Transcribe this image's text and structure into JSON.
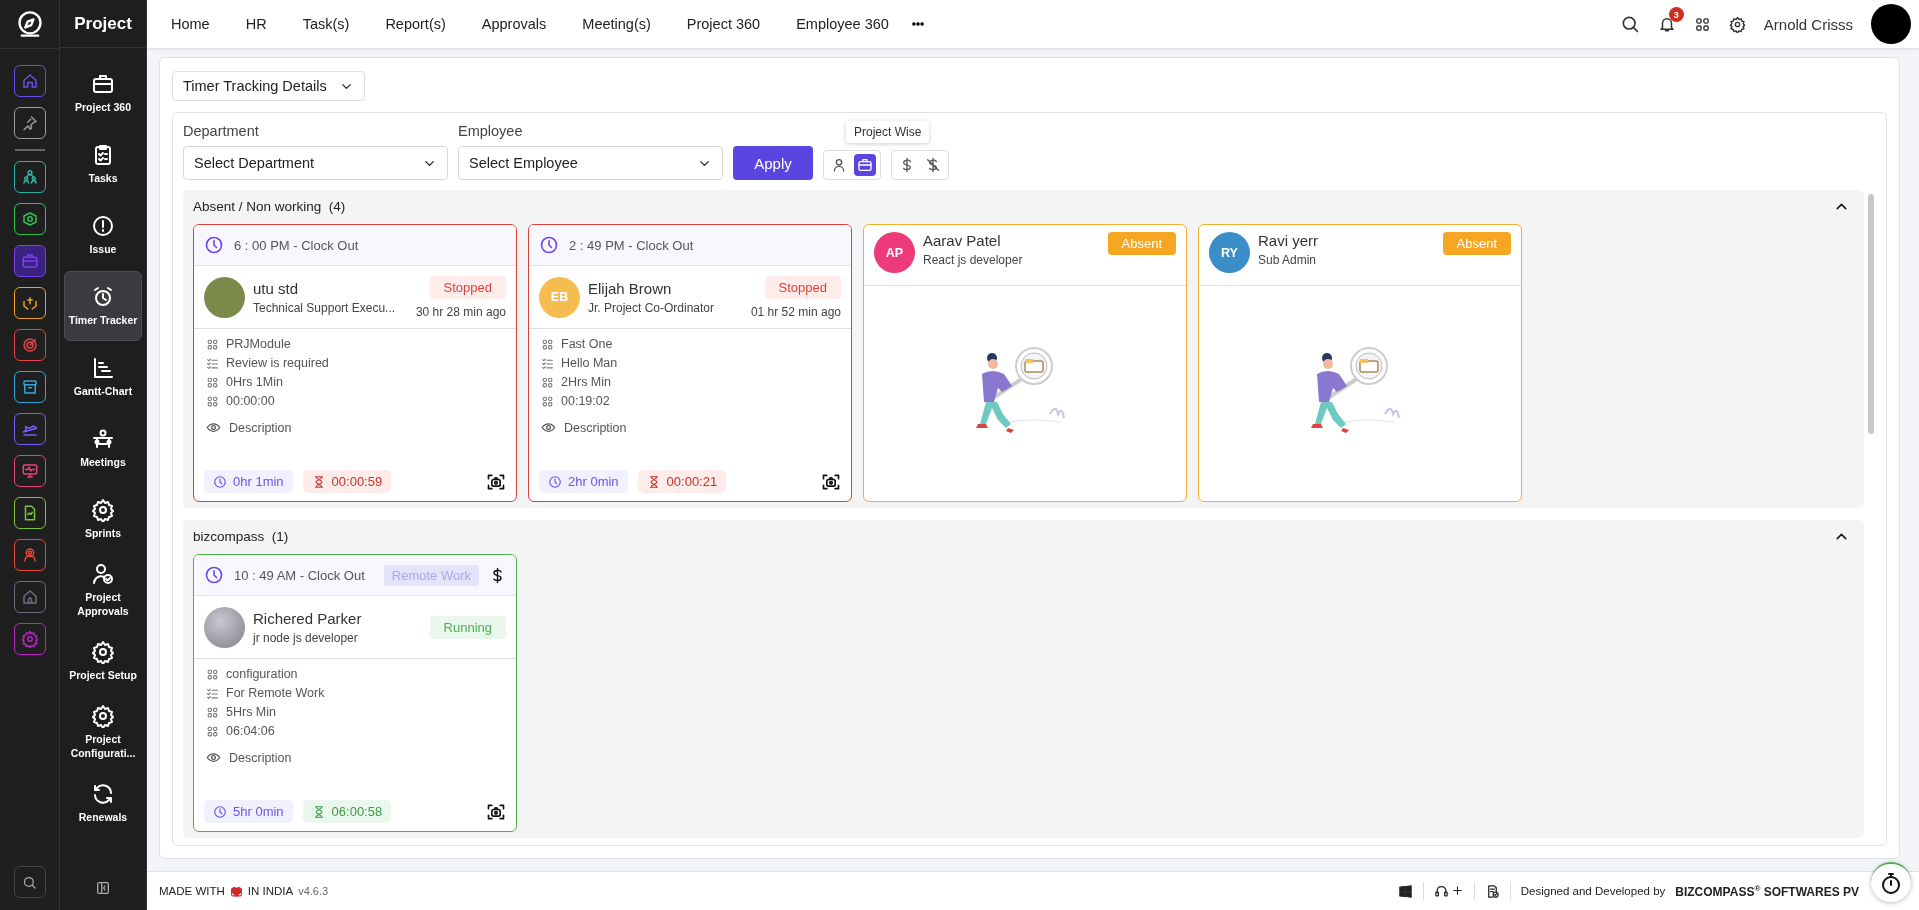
{
  "rail": {
    "items": [
      {
        "color": "#6a4cf0",
        "selected": false
      },
      {
        "color": "#9a9a9a",
        "selected": false
      },
      {
        "color": "#2bb3a3",
        "selected": false
      },
      {
        "color": "#35c14f",
        "selected": false
      },
      {
        "color": "#7b3ff2",
        "selected": true
      },
      {
        "color": "#f0a020",
        "selected": false
      },
      {
        "color": "#e8404a",
        "selected": false
      },
      {
        "color": "#2fa8d8",
        "selected": false
      },
      {
        "color": "#7b5cf5",
        "selected": false
      },
      {
        "color": "#e8407a",
        "selected": false
      },
      {
        "color": "#7ac33a",
        "selected": false
      },
      {
        "color": "#e8483a",
        "selected": false
      },
      {
        "color": "#6a7080",
        "selected": false
      },
      {
        "color": "#c020c8",
        "selected": false
      }
    ]
  },
  "sidebar": {
    "title": "Project",
    "items": [
      {
        "label": "Project 360",
        "selected": false
      },
      {
        "label": "Tasks",
        "selected": false
      },
      {
        "label": "Issue",
        "selected": false
      },
      {
        "label": "Timer Tracker",
        "selected": true
      },
      {
        "label": "Gantt-Chart",
        "selected": false
      },
      {
        "label": "Meetings",
        "selected": false
      },
      {
        "label": "Sprints",
        "selected": false
      },
      {
        "label": "Project Approvals",
        "selected": false
      },
      {
        "label": "Project Setup",
        "selected": false
      },
      {
        "label": "Project Configurati...",
        "selected": false
      },
      {
        "label": "Renewals",
        "selected": false
      }
    ]
  },
  "top_nav": {
    "items": [
      "Home",
      "HR",
      "Task(s)",
      "Report(s)",
      "Approvals",
      "Meeting(s)",
      "Project 360",
      "Employee 360"
    ],
    "notification_count": "3",
    "user_name": "Arnold Crisss"
  },
  "view_dropdown": {
    "value": "Timer Tracking Details"
  },
  "filters": {
    "department": {
      "label": "Department",
      "placeholder": "Select Department"
    },
    "employee": {
      "label": "Employee",
      "placeholder": "Select Employee"
    },
    "apply": "Apply",
    "view_toggles": [
      {
        "selected": false
      },
      {
        "selected": true
      }
    ],
    "tooltip": "Project Wise"
  },
  "groups": [
    {
      "title": "Absent / Non working",
      "count": "(4)",
      "expanded": true,
      "cards": [
        {
          "kind": "stopped",
          "clock_out": "6 : 00 PM - Clock Out",
          "avatar": {
            "kind": "photo"
          },
          "name": "utu std",
          "role": "Technical Support Execu...",
          "status": "Stopped",
          "ago": "30 hr 28 min ago",
          "details": [
            {
              "kind": "module",
              "text": "PRJModule"
            },
            {
              "kind": "task",
              "text": "Review is required"
            },
            {
              "kind": "module",
              "text": "0Hrs 1Min"
            },
            {
              "kind": "module",
              "text": "00:00:00"
            }
          ],
          "description": "Description",
          "duration": "0hr 1min",
          "timer": "00:00:59"
        },
        {
          "kind": "stopped",
          "clock_out": "2 : 49 PM - Clock Out",
          "avatar": {
            "kind": "initials",
            "initials": "EB",
            "color": "#f5bc50"
          },
          "name": "Elijah Brown",
          "role": "Jr. Project Co-Ordinator",
          "status": "Stopped",
          "ago": "01 hr 52 min ago",
          "details": [
            {
              "kind": "module",
              "text": "Fast One"
            },
            {
              "kind": "task",
              "text": "Hello Man"
            },
            {
              "kind": "module",
              "text": "2Hrs Min"
            },
            {
              "kind": "module",
              "text": "00:19:02"
            }
          ],
          "description": "Description",
          "duration": "2hr 0min",
          "timer": "00:00:21"
        },
        {
          "kind": "absent",
          "avatar": {
            "kind": "initials",
            "initials": "AP",
            "color": "#ec3a7a"
          },
          "name": "Aarav Patel",
          "role": "React js developer",
          "status": "Absent"
        },
        {
          "kind": "absent",
          "avatar": {
            "kind": "initials",
            "initials": "RY",
            "color": "#3a8ec8"
          },
          "name": "Ravi yerr",
          "role": "Sub Admin",
          "status": "Absent"
        }
      ]
    },
    {
      "title": "bizcompass",
      "count": "(1)",
      "expanded": true,
      "cards": [
        {
          "kind": "running",
          "clock_out": "10 : 49 AM - Clock Out",
          "tag": "Remote Work",
          "billable": true,
          "avatar": {
            "kind": "blur"
          },
          "name": "Richered Parker",
          "role": "jr node js developer",
          "status": "Running",
          "details": [
            {
              "kind": "module",
              "text": "configuration"
            },
            {
              "kind": "task",
              "text": "For Remote Work"
            },
            {
              "kind": "module",
              "text": "5Hrs Min"
            },
            {
              "kind": "module",
              "text": "06:04:06"
            }
          ],
          "description": "Description",
          "duration": "5hr 0min",
          "timer": "06:00:58"
        }
      ]
    }
  ],
  "footer": {
    "made_with": "MADE WITH",
    "in_india": "IN INDIA",
    "version": "v4.6.3",
    "designed_by": "Designed and Developed by",
    "company": "BIZCOMPASS$^{®}$ SOFTWARES PV"
  }
}
